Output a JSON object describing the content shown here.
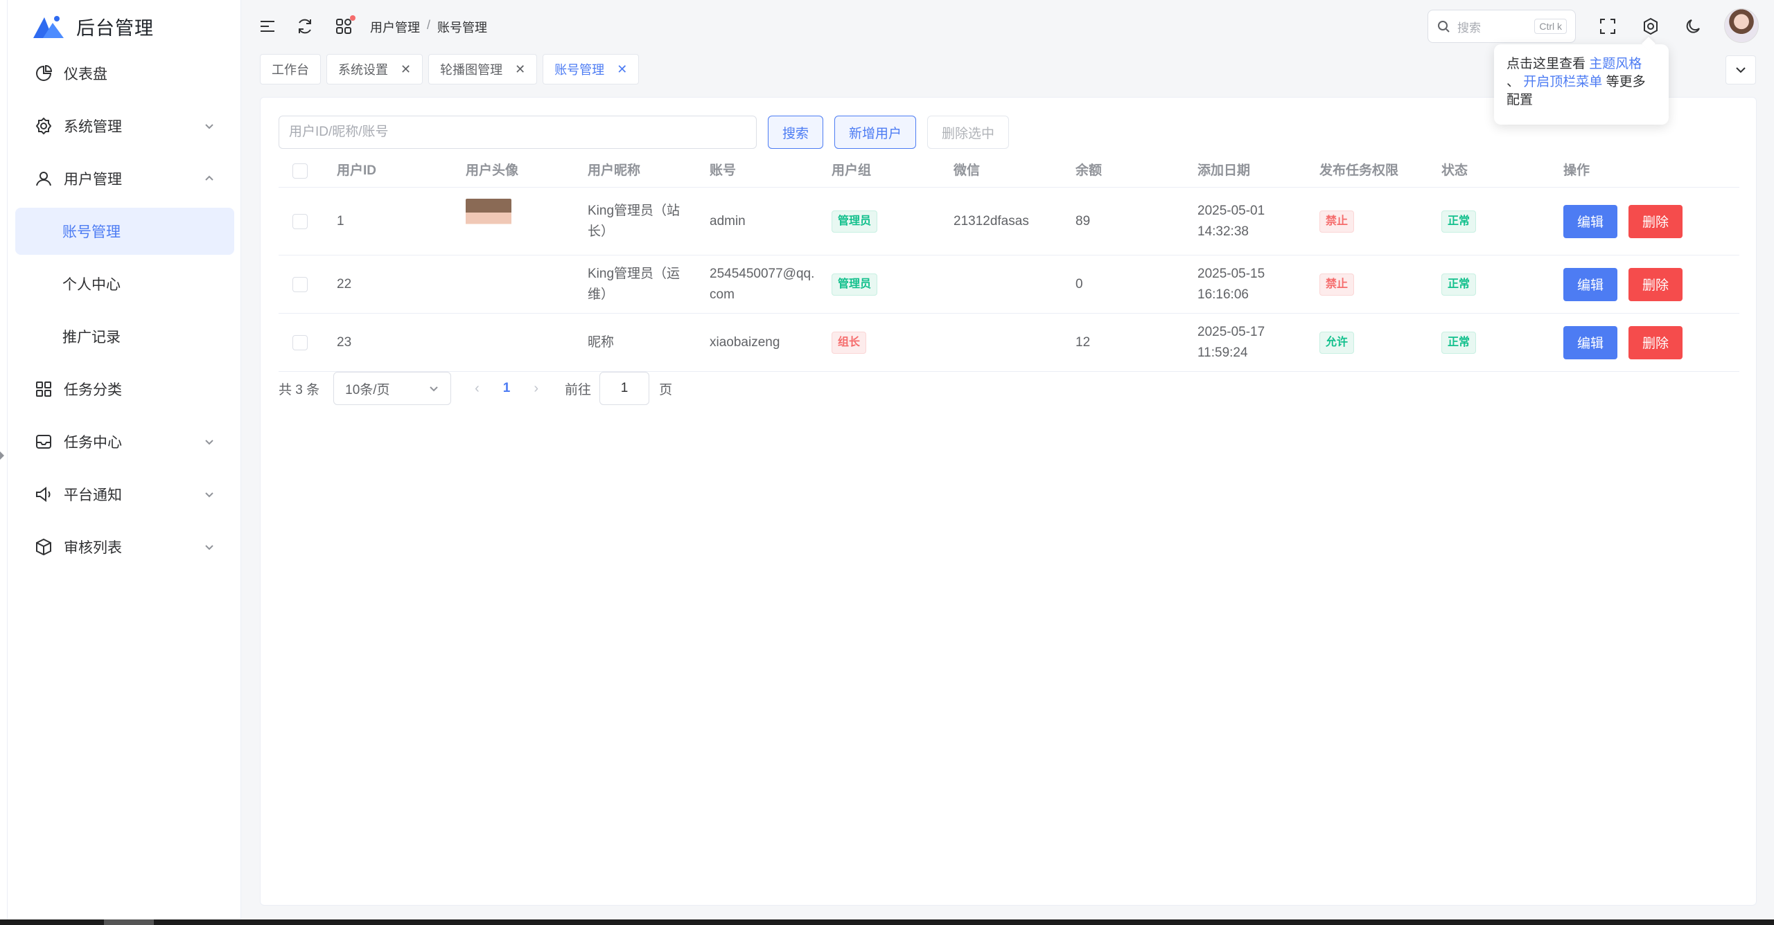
{
  "app": {
    "title": "后台管理"
  },
  "sidebar": {
    "items": [
      {
        "label": "仪表盘"
      },
      {
        "label": "系统管理"
      },
      {
        "label": "用户管理"
      },
      {
        "label": "账号管理"
      },
      {
        "label": "个人中心"
      },
      {
        "label": "推广记录"
      },
      {
        "label": "任务分类"
      },
      {
        "label": "任务中心"
      },
      {
        "label": "平台通知"
      },
      {
        "label": "审核列表"
      }
    ]
  },
  "header": {
    "breadcrumb": [
      "用户管理",
      "/",
      "账号管理"
    ],
    "search_placeholder": "搜索",
    "search_shortcut": "Ctrl k"
  },
  "tabs": [
    {
      "label": "工作台"
    },
    {
      "label": "系统设置"
    },
    {
      "label": "轮播图管理"
    },
    {
      "label": "账号管理"
    }
  ],
  "popover": {
    "text1": "点击这里查看 ",
    "link1": "主题风格",
    "text2": "、 ",
    "link2": "开启顶栏菜单",
    "text3": " 等更多配置"
  },
  "toolbar": {
    "search_placeholder": "用户ID/昵称/账号",
    "search_label": "搜索",
    "add_label": "新增用户",
    "delete_selected_label": "删除选中"
  },
  "table": {
    "columns": [
      "用户ID",
      "用户头像",
      "用户昵称",
      "账号",
      "用户组",
      "微信",
      "余额",
      "添加日期",
      "发布任务权限",
      "状态",
      "操作"
    ],
    "rows": [
      {
        "id": "1",
        "nickname": "King管理员（站长）",
        "account": "admin",
        "group": "管理员",
        "wechat": "21312dfasas",
        "balance": "89",
        "date": "2025-05-01 14:32:38",
        "permission": "禁止",
        "status": "正常",
        "edit": "编辑",
        "delete": "删除"
      },
      {
        "id": "22",
        "nickname": "King管理员（运维）",
        "account": "2545450077@qq.com",
        "group": "管理员",
        "wechat": "",
        "balance": "0",
        "date": "2025-05-15 16:16:06",
        "permission": "禁止",
        "status": "正常",
        "edit": "编辑",
        "delete": "删除"
      },
      {
        "id": "23",
        "nickname": "昵称",
        "account": "xiaobaizeng",
        "group": "组长",
        "wechat": "",
        "balance": "12",
        "date": "2025-05-17 11:59:24",
        "permission": "允许",
        "status": "正常",
        "edit": "编辑",
        "delete": "删除"
      }
    ]
  },
  "pagination": {
    "total": "共 3 条",
    "page_size": "10条/页",
    "current_page": "1",
    "goto_label": "前往",
    "goto_value": "1",
    "page_word": "页"
  },
  "colors": {
    "primary": "#4d7cf3",
    "danger": "#f54c4c",
    "success": "#13c08d"
  }
}
